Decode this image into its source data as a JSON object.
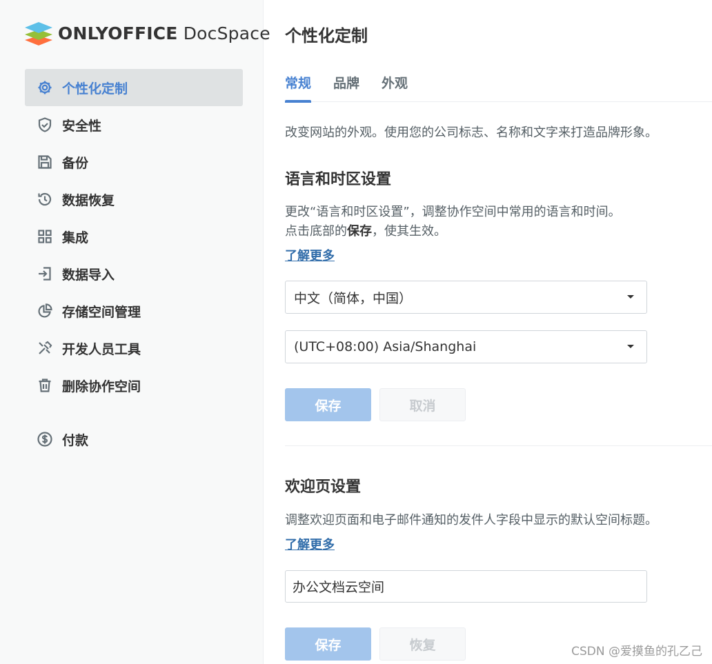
{
  "brand": {
    "logo_icon": "onlyoffice-layers-logo",
    "name_bold": "ONLYOFFICE",
    "name_regular": " DocSpace"
  },
  "sidebar": {
    "items": [
      {
        "label": "个性化定制",
        "icon": "gear-icon",
        "active": true
      },
      {
        "label": "安全性",
        "icon": "shield-icon"
      },
      {
        "label": "备份",
        "icon": "floppy-icon"
      },
      {
        "label": "数据恢复",
        "icon": "history-icon"
      },
      {
        "label": "集成",
        "icon": "grid-icon"
      },
      {
        "label": "数据导入",
        "icon": "import-icon"
      },
      {
        "label": "存储空间管理",
        "icon": "pie-chart-icon"
      },
      {
        "label": "开发人员工具",
        "icon": "tools-icon"
      },
      {
        "label": "删除协作空间",
        "icon": "trash-icon"
      },
      {
        "label": "付款",
        "icon": "dollar-icon"
      }
    ]
  },
  "main": {
    "title": "个性化定制",
    "tabs": [
      {
        "label": "常规",
        "active": true
      },
      {
        "label": "品牌"
      },
      {
        "label": "外观"
      }
    ],
    "intro": "改变网站的外观。使用您的公司标志、名称和文字来打造品牌形象。",
    "language_section": {
      "title": "语言和时区设置",
      "desc_line1": "更改“语言和时区设置”，调整协作空间中常用的语言和时间。",
      "desc_line2_prefix": "点击底部的",
      "desc_line2_bold": "保存",
      "desc_line2_suffix": "，使其生效。",
      "learn_more": "了解更多",
      "language_value": "中文（简体，中国）",
      "timezone_value": "(UTC+08:00) Asia/Shanghai",
      "save_label": "保存",
      "cancel_label": "取消"
    },
    "welcome_section": {
      "title": "欢迎页设置",
      "desc": "调整欢迎页面和电子邮件通知的发件人字段中显示的默认空间标题。",
      "learn_more": "了解更多",
      "input_value": "办公文档云空间",
      "save_label": "保存",
      "restore_label": "恢复"
    }
  },
  "watermark": "CSDN @爱摸鱼的孔乙己",
  "colors": {
    "accent": "#4781d1",
    "link": "#316daa",
    "primary_disabled": "#a3c5ec",
    "active_nav_bg": "#dfe2e3"
  }
}
